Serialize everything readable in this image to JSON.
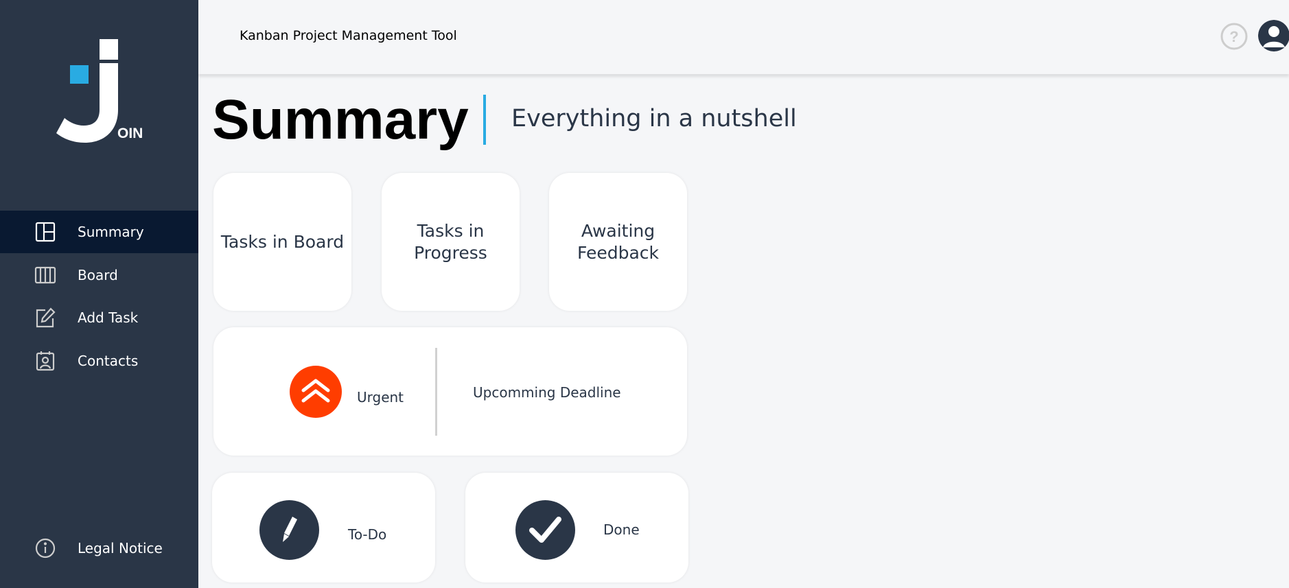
{
  "app": {
    "logo_text": "OIN",
    "header_title": "Kanban Project Management Tool"
  },
  "sidebar": {
    "items": [
      {
        "label": "Summary",
        "icon": "summary-icon"
      },
      {
        "label": "Board",
        "icon": "board-icon"
      },
      {
        "label": "Add Task",
        "icon": "add-task-icon"
      },
      {
        "label": "Contacts",
        "icon": "contacts-icon"
      }
    ],
    "legal": {
      "label": "Legal Notice",
      "icon": "info-icon"
    }
  },
  "page": {
    "title": "Summary",
    "subtitle": "Everything in a nutshell"
  },
  "cards": {
    "tasks_in_board": "Tasks in Board",
    "tasks_in_progress": "Tasks in Progress",
    "awaiting_feedback": "Awaiting Feedback",
    "urgent": "Urgent",
    "upcoming_deadline": "Upcomming Deadline",
    "todo": "To-Do",
    "done": "Done"
  },
  "colors": {
    "sidebar": "#2A3647",
    "sidebar_active": "#091931",
    "accent": "#29ABE2",
    "urgent": "#FF3D00",
    "background": "#F5F6F8"
  }
}
